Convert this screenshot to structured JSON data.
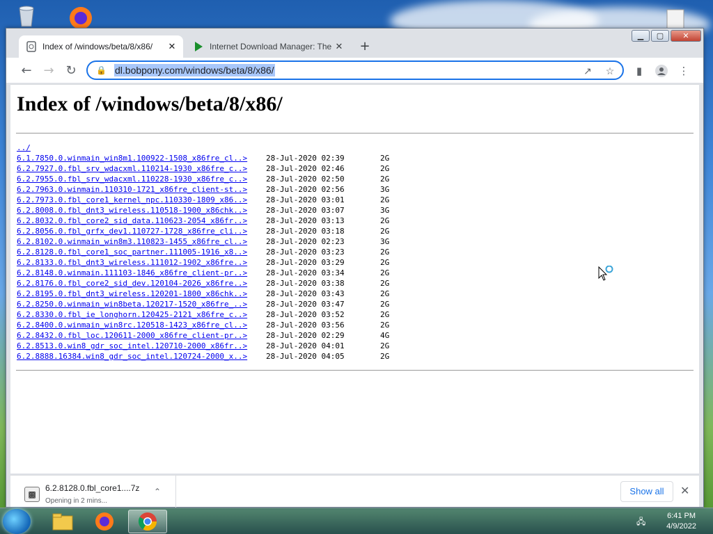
{
  "browser": {
    "tabs": [
      {
        "title": "Index of /windows/beta/8/x86/",
        "active": true
      },
      {
        "title": "Internet Download Manager: The",
        "active": false
      }
    ],
    "new_tab_symbol": "+",
    "close_symbol": "✕",
    "address": "dl.bobpony.com/windows/beta/8/x86/",
    "window_controls": {
      "minimize": "▁",
      "maximize": "▢",
      "close": "✕"
    }
  },
  "page": {
    "heading": "Index of /windows/beta/8/x86/",
    "parent_link": "../",
    "entries": [
      {
        "name": "6.1.7850.0.winmain_win8m1.100922-1508_x86fre_cl..>",
        "date": "28-Jul-2020 02:39",
        "size": "2G"
      },
      {
        "name": "6.2.7927.0.fbl_srv_wdacxml.110214-1930_x86fre_c..>",
        "date": "28-Jul-2020 02:46",
        "size": "2G"
      },
      {
        "name": "6.2.7955.0.fbl_srv_wdacxml.110228-1930_x86fre_c..>",
        "date": "28-Jul-2020 02:50",
        "size": "2G"
      },
      {
        "name": "6.2.7963.0.winmain.110310-1721_x86fre_client-st..>",
        "date": "28-Jul-2020 02:56",
        "size": "3G"
      },
      {
        "name": "6.2.7973.0.fbl_core1_kernel_npc.110330-1809_x86..>",
        "date": "28-Jul-2020 03:01",
        "size": "2G"
      },
      {
        "name": "6.2.8008.0.fbl_dnt3_wireless.110518-1900_x86chk..>",
        "date": "28-Jul-2020 03:07",
        "size": "3G"
      },
      {
        "name": "6.2.8032.0.fbl_core2_sid_data.110623-2054_x86fr..>",
        "date": "28-Jul-2020 03:13",
        "size": "2G"
      },
      {
        "name": "6.2.8056.0.fbl_grfx_dev1.110727-1728_x86fre_cli..>",
        "date": "28-Jul-2020 03:18",
        "size": "2G"
      },
      {
        "name": "6.2.8102.0.winmain_win8m3.110823-1455_x86fre_cl..>",
        "date": "28-Jul-2020 02:23",
        "size": "3G"
      },
      {
        "name": "6.2.8128.0.fbl_core1_soc_partner.111005-1916_x8..>",
        "date": "28-Jul-2020 03:23",
        "size": "2G"
      },
      {
        "name": "6.2.8133.0.fbl_dnt3_wireless.111012-1902_x86fre..>",
        "date": "28-Jul-2020 03:29",
        "size": "2G"
      },
      {
        "name": "6.2.8148.0.winmain.111103-1846_x86fre_client-pr..>",
        "date": "28-Jul-2020 03:34",
        "size": "2G"
      },
      {
        "name": "6.2.8176.0.fbl_core2_sid_dev.120104-2026_x86fre..>",
        "date": "28-Jul-2020 03:38",
        "size": "2G"
      },
      {
        "name": "6.2.8195.0.fbl_dnt3_wireless.120201-1800_x86chk..>",
        "date": "28-Jul-2020 03:43",
        "size": "2G"
      },
      {
        "name": "6.2.8250.0.winmain_win8beta.120217-1520_x86fre_..>",
        "date": "28-Jul-2020 03:47",
        "size": "2G"
      },
      {
        "name": "6.2.8330.0.fbl_ie_longhorn.120425-2121_x86fre_c..>",
        "date": "28-Jul-2020 03:52",
        "size": "2G"
      },
      {
        "name": "6.2.8400.0.winmain_win8rc.120518-1423_x86fre_cl..>",
        "date": "28-Jul-2020 03:56",
        "size": "2G"
      },
      {
        "name": "6.2.8432.0.fbl_loc.120611-2000_x86fre_client-pr..>",
        "date": "28-Jul-2020 02:29",
        "size": "4G"
      },
      {
        "name": "6.2.8513.0.win8_gdr_soc_intel.120710-2000_x86fr..>",
        "date": "28-Jul-2020 04:01",
        "size": "2G"
      },
      {
        "name": "6.2.8888.16384.win8_gdr_soc_intel.120724-2000_x..>",
        "date": "28-Jul-2020 04:05",
        "size": "2G"
      }
    ]
  },
  "downloads": {
    "file_name": "6.2.8128.0.fbl_core1....7z",
    "status": "Opening in 2 mins...",
    "show_all_label": "Show all"
  },
  "taskbar": {
    "time": "6:41 PM",
    "date": "4/9/2022"
  },
  "colors": {
    "link": "#0000ee",
    "accent": "#1a73e8",
    "url_highlight": "#a8c7fa"
  }
}
